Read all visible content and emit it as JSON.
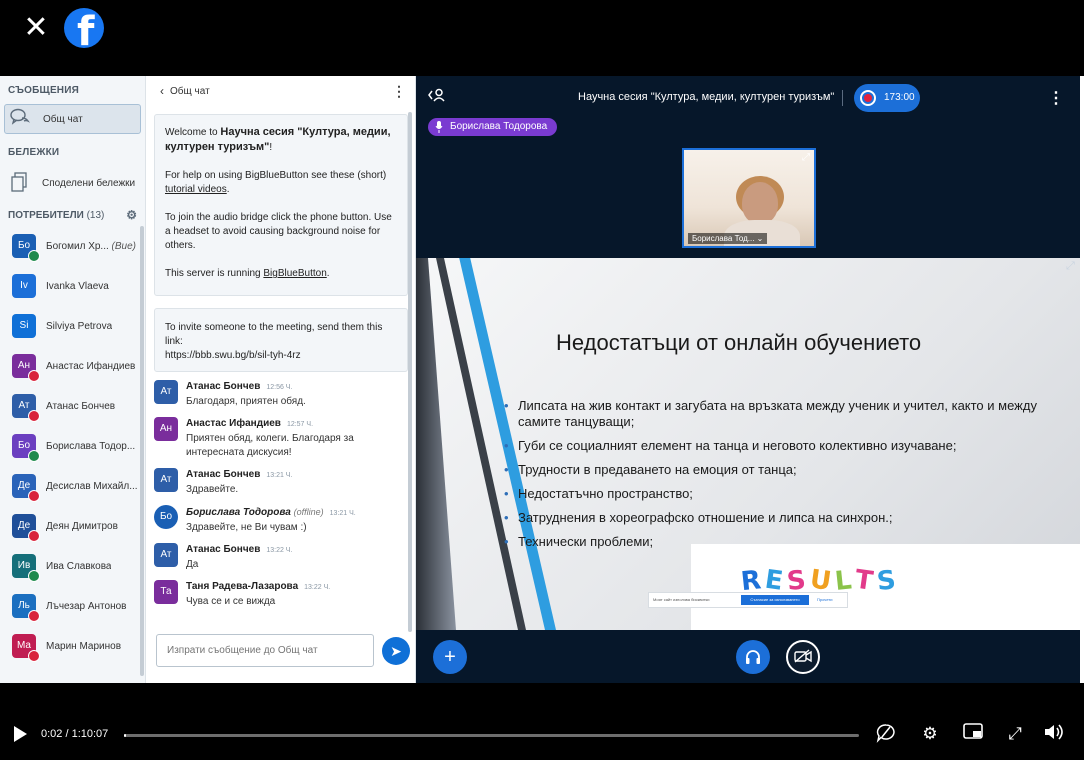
{
  "facebook": {
    "close_icon": "close-icon",
    "logo": "f"
  },
  "sidebar": {
    "messages_title": "СЪОБЩЕНИЯ",
    "public_chat": "Общ чат",
    "notes_title": "БЕЛЕЖКИ",
    "shared_notes": "Споделени бележки",
    "users_title": "ПОТРЕБИТЕЛИ",
    "users_count": "(13)",
    "users": [
      {
        "initials": "Бо",
        "name": "Богомил Хр...",
        "suffix": "(Вие)",
        "color": "#1a5fb4",
        "status": "#1f8a4c",
        "circle": false
      },
      {
        "initials": "Iv",
        "name": "Ivanka Vlaeva",
        "suffix": "",
        "color": "#1c6fd8",
        "status": "",
        "circle": false
      },
      {
        "initials": "Si",
        "name": "Silviya Petrova",
        "suffix": "",
        "color": "#0f70d7",
        "status": "",
        "circle": false
      },
      {
        "initials": "Ан",
        "name": "Анастас Ифандиев",
        "suffix": "",
        "color": "#7a2d9c",
        "status": "#d9243c",
        "circle": false
      },
      {
        "initials": "Ат",
        "name": "Атанас Бончев",
        "suffix": "",
        "color": "#2e5ea8",
        "status": "#d9243c",
        "circle": false
      },
      {
        "initials": "Бо",
        "name": "Борислава Тодор...",
        "suffix": "",
        "color": "#6b3fc0",
        "status": "#1f8a4c",
        "circle": false
      },
      {
        "initials": "Де",
        "name": "Десислав Михайл...",
        "suffix": "",
        "color": "#2a63b9",
        "status": "#d9243c",
        "circle": false
      },
      {
        "initials": "Де",
        "name": "Деян Димитров",
        "suffix": "",
        "color": "#1f4f99",
        "status": "#d9243c",
        "circle": false
      },
      {
        "initials": "Ив",
        "name": "Ива Славкова",
        "suffix": "",
        "color": "#156f7a",
        "status": "#1f8a4c",
        "circle": false
      },
      {
        "initials": "Ль",
        "name": "Лъчезар Антонов",
        "suffix": "",
        "color": "#1b6fc0",
        "status": "#d9243c",
        "circle": false
      },
      {
        "initials": "Ма",
        "name": "Марин Маринов",
        "suffix": "",
        "color": "#c01d52",
        "status": "#d9243c",
        "circle": false
      }
    ]
  },
  "chat": {
    "title": "Общ чат",
    "welcome": {
      "prefix": "Welcome to ",
      "session": "Научна сесия \"Култура, медии, културен туризъм\"",
      "exclaim": "!",
      "help_prefix": "For help on using BigBlueButton see these (short) ",
      "help_link": "tutorial videos",
      "help_suffix": ".",
      "audio": "To join the audio bridge click the phone button. Use a headset to avoid causing background noise for others.",
      "server_prefix": "This server is running ",
      "server_link": "BigBlueButton",
      "server_suffix": "."
    },
    "invite": "To invite someone to the meeting, send them this link:",
    "invite_link": "https://bbb.swu.bg/b/sil-tyh-4rz",
    "messages": [
      {
        "initials": "Ат",
        "name": "Атанас Бончев",
        "italic": false,
        "offline": "",
        "time": "12:56 Ч.",
        "text": "Благодаря, приятен обяд.",
        "color": "#2e5ea8",
        "circle": false
      },
      {
        "initials": "Ан",
        "name": "Анастас Ифандиев",
        "italic": false,
        "offline": "",
        "time": "12:57 Ч.",
        "text": "Приятен обяд, колеги. Благодаря за интересната дискусия!",
        "color": "#7a2d9c",
        "circle": false
      },
      {
        "initials": "Ат",
        "name": "Атанас Бончев",
        "italic": false,
        "offline": "",
        "time": "13:21 Ч.",
        "text": "Здравейте.",
        "color": "#2e5ea8",
        "circle": false
      },
      {
        "initials": "Бо",
        "name": "Борислава Тодорова",
        "italic": true,
        "offline": "(offline)",
        "time": "13:21 Ч.",
        "text": "Здравейте, не Ви чувам :)",
        "color": "#1a5fb4",
        "circle": true
      },
      {
        "initials": "Ат",
        "name": "Атанас Бончев",
        "italic": false,
        "offline": "",
        "time": "13:22 Ч.",
        "text": "Да",
        "color": "#2e5ea8",
        "circle": false
      },
      {
        "initials": "Та",
        "name": "Таня Радева-Лазарова",
        "italic": false,
        "offline": "",
        "time": "13:22 Ч.",
        "text": "Чува се и се вижда",
        "color": "#7a2d9c",
        "circle": false
      }
    ],
    "input_placeholder": "Изпрати съобщение до Общ чат"
  },
  "stage": {
    "title": "Научна сесия \"Култура, медии, културен туризъм\"",
    "recording_time": "173:00",
    "talker": "Борислава Тодорова",
    "webcam_label": "Борислава Тод...",
    "slide_title": "Недостатъци от онлайн обучението",
    "bullets": [
      "Липсата на жив контакт и загубата на връзката между ученик и учител, както и между самите танцуващи;",
      "Губи се социалният елемент на танца и неговото колективно изучаване;",
      "Трудности в предаването на емоция от танца;",
      "Недостатъчно пространство;",
      "Затруднения в хореографско отношение и липса на синхрон.;",
      "Технически проблеми;"
    ],
    "results_letters": [
      "R",
      "E",
      "S",
      "U",
      "L",
      "T",
      "S"
    ],
    "results_colors": [
      "#1c6fd8",
      "#2e9de0",
      "#e23a8a",
      "#f0a020",
      "#8bc34a",
      "#e23a8a",
      "#2e9de0"
    ],
    "banner_text": "Моят сайт използва бисквитки",
    "banner_button": "Съгласие за използването",
    "banner_link": "Прочети"
  },
  "player": {
    "time": "0:02 / 1:10:07",
    "progress": 0.0005
  }
}
